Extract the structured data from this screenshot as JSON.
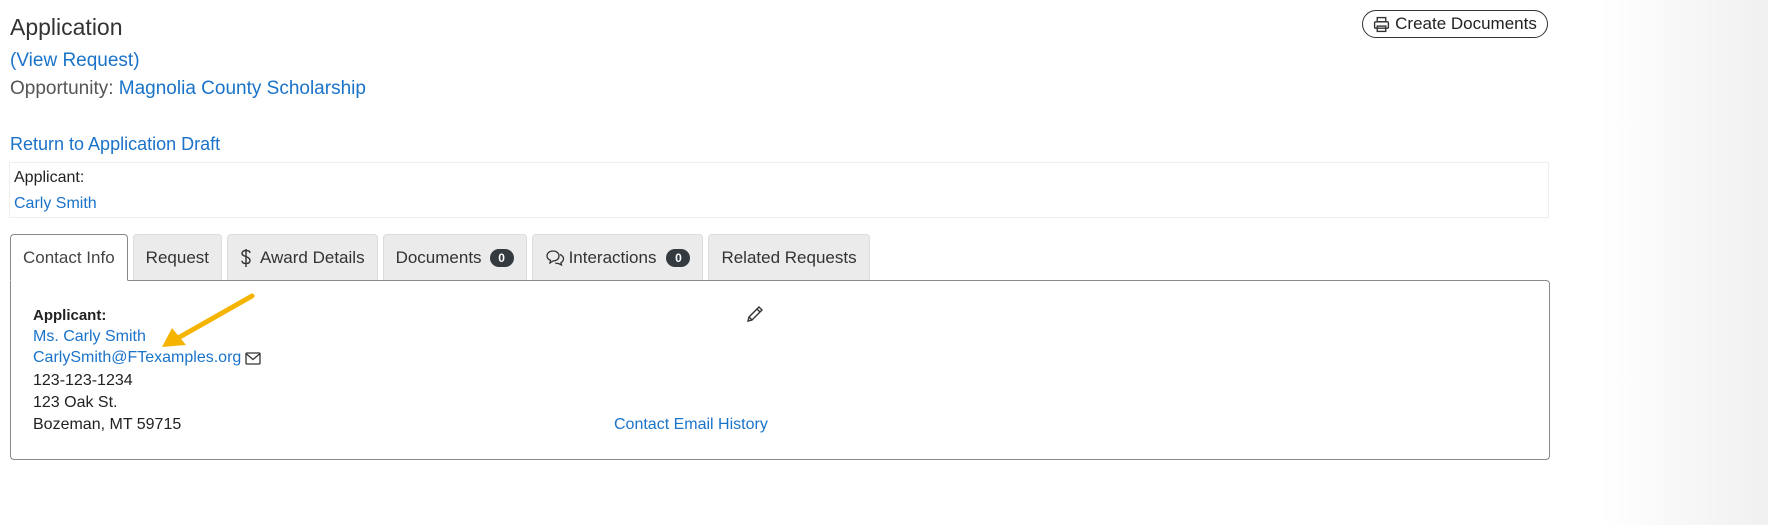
{
  "header": {
    "title": "Application",
    "view_request": "(View Request)",
    "opportunity_label": "Opportunity:",
    "opportunity_name": "Magnolia County Scholarship",
    "return_link": "Return to Application Draft",
    "create_documents": "Create Documents"
  },
  "applicant_summary": {
    "label": "Applicant:",
    "name": "Carly Smith"
  },
  "tabs": [
    {
      "label": "Contact Info",
      "active": true
    },
    {
      "label": "Request"
    },
    {
      "label": "Award Details",
      "icon": "dollar-icon"
    },
    {
      "label": "Documents",
      "badge": "0"
    },
    {
      "label": "Interactions",
      "icon": "chat-bubbles-icon",
      "badge": "0"
    },
    {
      "label": "Related Requests"
    }
  ],
  "contact": {
    "label": "Applicant:",
    "name": "Ms. Carly Smith",
    "email": "CarlySmith@FTexamples.org",
    "phone": "123-123-1234",
    "street": "123 Oak St.",
    "city_state_zip": "Bozeman, MT 59715",
    "email_history": "Contact Email History"
  },
  "colors": {
    "link": "#1a73c9",
    "annotation_arrow": "#f5b400",
    "badge": "#333a40"
  }
}
